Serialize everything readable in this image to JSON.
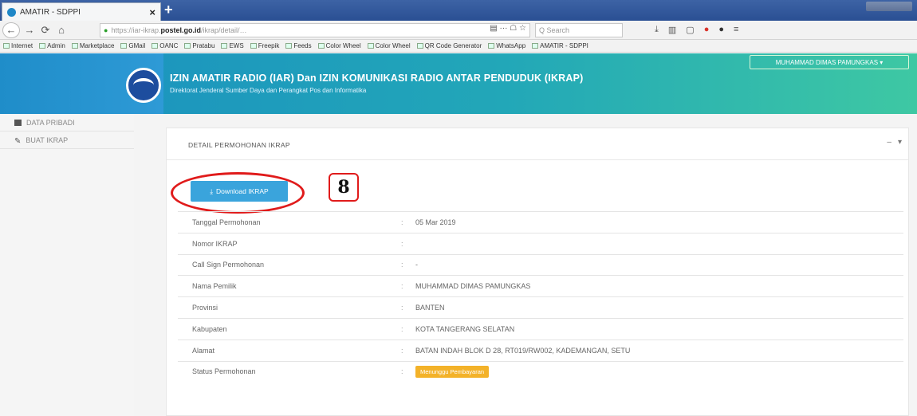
{
  "browser": {
    "tab_title": "AMATIR - SDPPI",
    "tab_close": "×",
    "new_tab": "+",
    "back": "←",
    "forward": "→",
    "reload": "⟳",
    "home": "⌂",
    "url_prefix": "https://iar-ikrap.",
    "url_domain": "postel.go.id",
    "url_rest": "/ikrap/detail/…",
    "url_actions": "▤  ··· ☖ ☆",
    "search_placeholder": "Q  Search"
  },
  "bookmarks": [
    "Internet",
    "Admin",
    "Marketplace",
    "GMail",
    "OANC",
    "Pratabu",
    "EWS",
    "Freepik",
    "Feeds",
    "Color Wheel",
    "Color Wheel",
    "QR Code Generator",
    "WhatsApp",
    "AMATIR - SDPPI"
  ],
  "site": {
    "title": "IZIN AMATIR RADIO (IAR) Dan IZIN KOMUNIKASI RADIO ANTAR PENDUDUK (IKRAP)",
    "subtitle": "Direktorat Jenderal Sumber Daya dan Perangkat Pos dan Informatika",
    "user_button": "MUHAMMAD DIMAS PAMUNGKAS ▾"
  },
  "sidebar": {
    "items": [
      {
        "label": "DATA PRIBADI"
      },
      {
        "label": "BUAT IKRAP"
      }
    ]
  },
  "panel": {
    "title": "DETAIL PERMOHONAN IKRAP",
    "tools": [
      "–",
      "▾"
    ],
    "download_label": "Download IKRAP",
    "download_icon": "⤓",
    "step_number": "8"
  },
  "details": [
    {
      "label": "Tanggal Permohonan",
      "sep": ":",
      "value": "05 Mar 2019"
    },
    {
      "label": "Nomor IKRAP",
      "sep": ":",
      "value": ""
    },
    {
      "label": "Call Sign Permohonan",
      "sep": ":",
      "value": "-"
    },
    {
      "label": "Nama Pemilik",
      "sep": ":",
      "value": "MUHAMMAD DIMAS PAMUNGKAS"
    },
    {
      "label": "Provinsi",
      "sep": ":",
      "value": "BANTEN"
    },
    {
      "label": "Kabupaten",
      "sep": ":",
      "value": "KOTA TANGERANG SELATAN"
    },
    {
      "label": "Alamat",
      "sep": ":",
      "value": "BATAN INDAH BLOK D 28, RT019/RW002, KADEMANGAN, SETU"
    },
    {
      "label": "Status Permohonan",
      "sep": ":",
      "value": "Menunggu Pembayaran"
    }
  ]
}
